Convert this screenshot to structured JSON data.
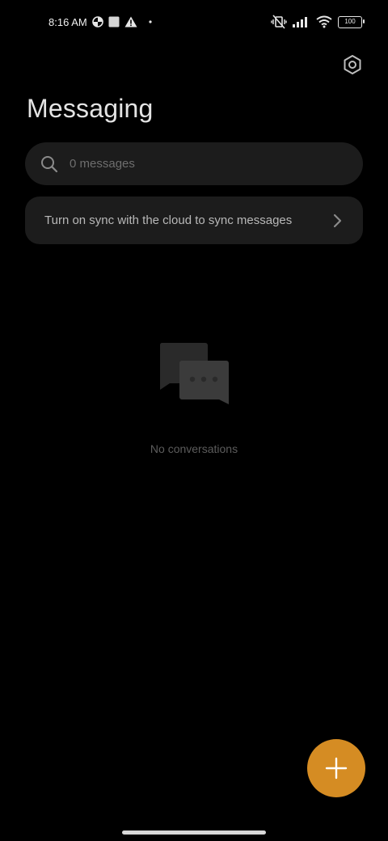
{
  "status_bar": {
    "time": "8:16 AM",
    "left_icons": [
      "data-saver-icon",
      "square-notification-icon",
      "warning-icon",
      "dot-icon"
    ],
    "right_icons": [
      "vibrate-off-icon",
      "signal-icon",
      "wifi-icon"
    ],
    "battery": "100"
  },
  "header": {
    "title": "Messaging",
    "settings_icon": "settings-hexagon-icon"
  },
  "search": {
    "placeholder": "0 messages"
  },
  "sync_card": {
    "text": "Turn on sync with the cloud to sync messages"
  },
  "empty_state": {
    "icon": "chat-bubbles-icon",
    "text": "No conversations"
  },
  "fab": {
    "icon": "plus-icon",
    "color": "#d58c23"
  },
  "colors": {
    "background": "#000000",
    "card": "#1c1c1c",
    "accent": "#d58c23"
  }
}
